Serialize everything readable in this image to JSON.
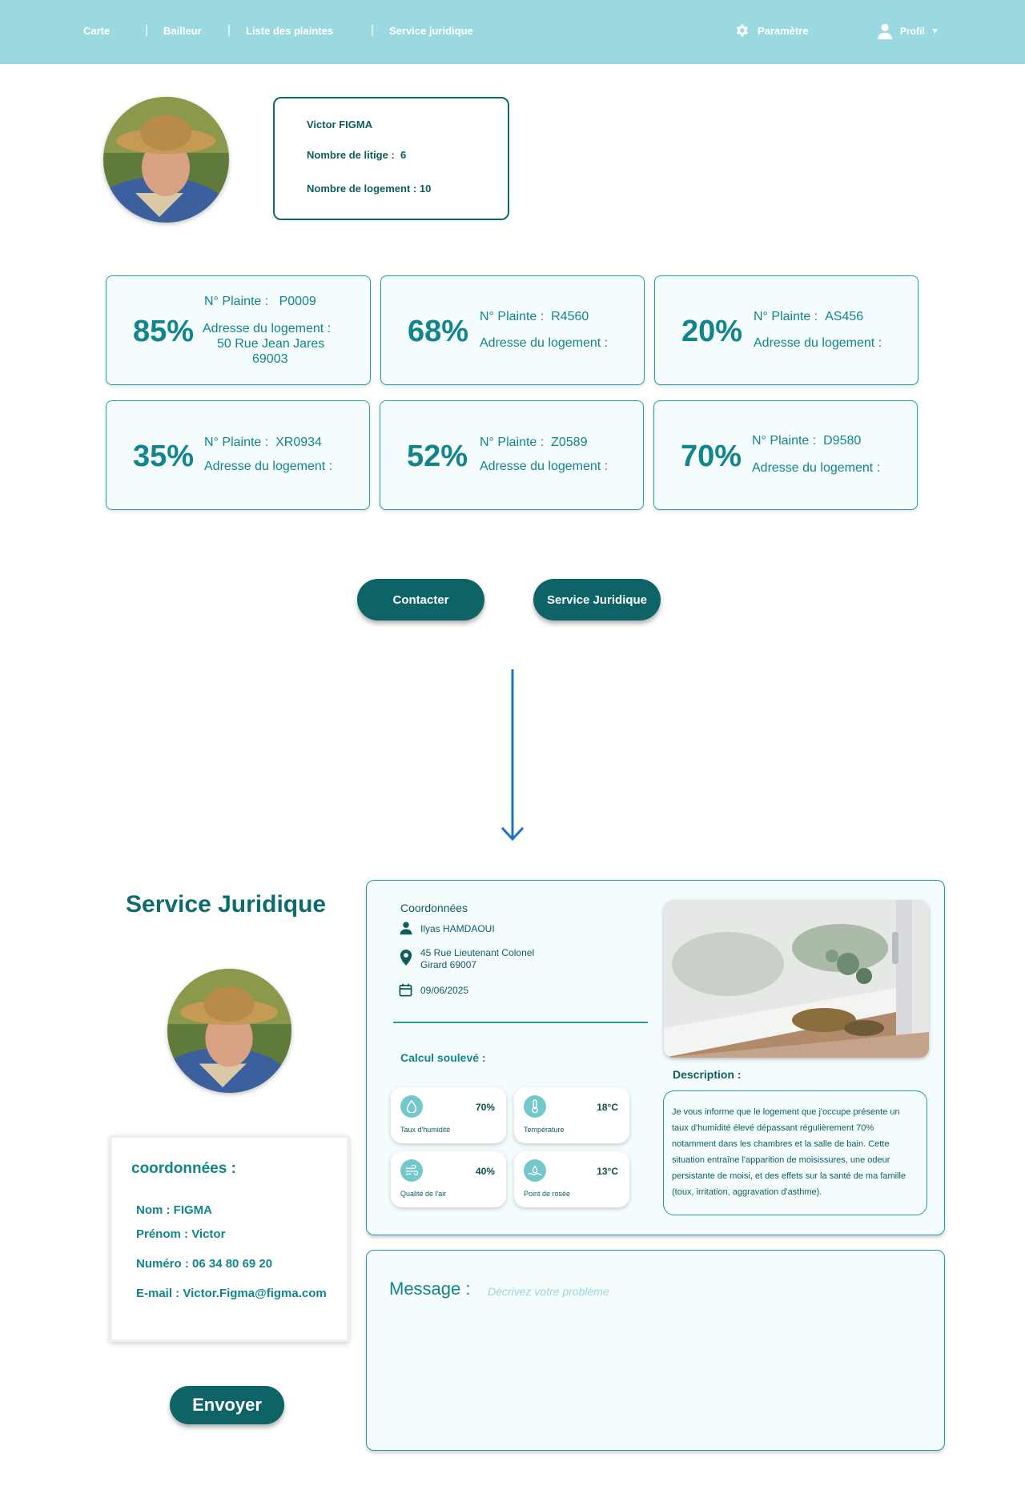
{
  "nav": {
    "items": [
      "Carte",
      "Bailleur",
      "Liste des plaintes",
      "Service juridique"
    ],
    "settings_label": "Paramètre",
    "profile_label": "Profil"
  },
  "profile": {
    "name": "Victor FIGMA",
    "disputes_label": "Nombre de litige :",
    "disputes_value": "6",
    "housing_label": "Nombre de logement : 10"
  },
  "complaints": [
    {
      "pct": "85%",
      "num_label": "N° Plainte :",
      "num": "P0009",
      "addr_label": "Adresse du logement :",
      "addr": "50 Rue Jean Jares",
      "addr2": "69003"
    },
    {
      "pct": "68%",
      "num_label": "N° Plainte :",
      "num": "R4560",
      "addr_label": "Adresse du logement :",
      "addr": "",
      "addr2": ""
    },
    {
      "pct": "20%",
      "num_label": "N° Plainte :",
      "num": "AS456",
      "addr_label": "Adresse du logement :",
      "addr": "",
      "addr2": ""
    },
    {
      "pct": "35%",
      "num_label": "N° Plainte :",
      "num": "XR0934",
      "addr_label": "Adresse du logement :",
      "addr": "",
      "addr2": ""
    },
    {
      "pct": "52%",
      "num_label": "N° Plainte :",
      "num": "Z0589",
      "addr_label": "Adresse du logement :",
      "addr": "",
      "addr2": ""
    },
    {
      "pct": "70%",
      "num_label": "N° Plainte :",
      "num": "D9580",
      "addr_label": "Adresse du logement :",
      "addr": "",
      "addr2": ""
    }
  ],
  "actions": {
    "contact": "Contacter",
    "legal": "Service Juridique"
  },
  "legal": {
    "title": "Service Juridique",
    "coords_title": "coordonnées :",
    "nom_label": "Nom :",
    "nom": "FIGMA",
    "prenom_label": "Prénom :",
    "prenom": "Victor",
    "numero_label": "Numéro :",
    "numero": "06 34 80 69 20",
    "email_label": "E-mail :",
    "email": "Victor.Figma@figma.com",
    "send": "Envoyer"
  },
  "details": {
    "coords_head": "Coordonnées",
    "person": "Ilyas HAMDAOUI",
    "address_line1": "45 Rue Lieutenant Colonel",
    "address_line2": "Girard 69007",
    "date": "09/06/2025",
    "calc_head": "Calcul soulevé :",
    "metrics": [
      {
        "label": "Taux d'humidité",
        "value": "70%",
        "icon": "droplet-icon"
      },
      {
        "label": "Température",
        "value": "18°C",
        "icon": "thermometer-icon"
      },
      {
        "label": "Qualité de l'air",
        "value": "40%",
        "icon": "air-icon"
      },
      {
        "label": "Point de rosée",
        "value": "13°C",
        "icon": "dew-point-icon"
      }
    ],
    "desc_head": "Description :",
    "desc_text": "Je vous informe que le logement que j'occupe présente un taux d'humidité élevé dépassant régulièrement 70% notamment dans les chambres et la salle de bain. Cette situation entraîne l'apparition de moisissures, une odeur persistante de moisi, et des effets sur la santé de ma famille (toux, irritation, aggravation d'asthme)."
  },
  "message": {
    "label": "Message :",
    "placeholder": "Décrivez votre problème"
  },
  "colors": {
    "nav_bg": "#9bd9e0",
    "accent": "#12858a",
    "dark": "#0d6366",
    "arrow": "#1a73c9"
  }
}
